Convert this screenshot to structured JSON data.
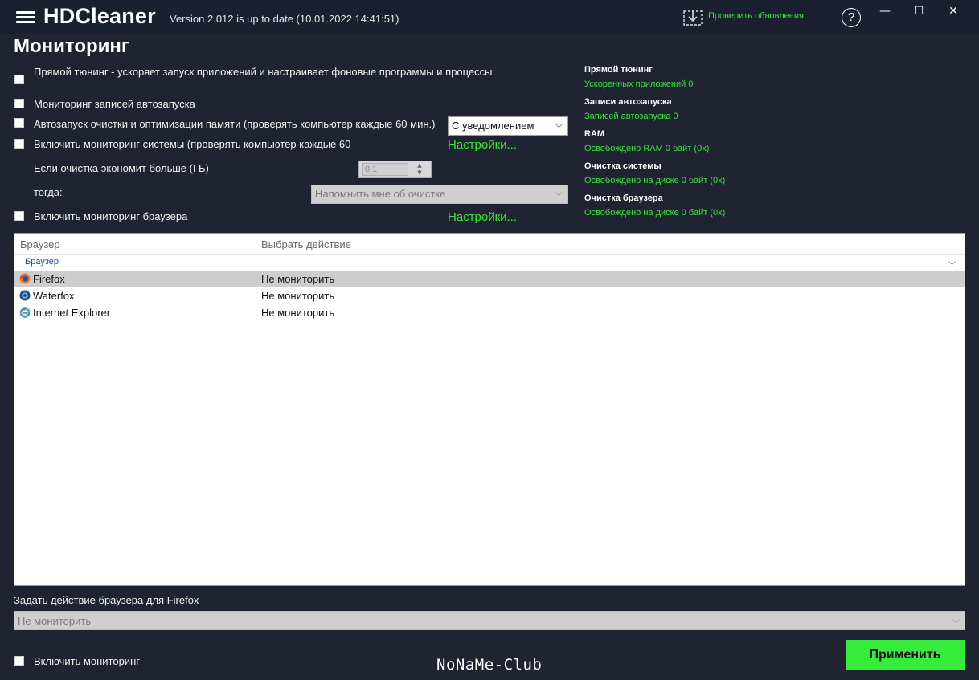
{
  "app": {
    "title": "HDCleaner",
    "version": "Version 2.012 is up to date (10.01.2022 14:41:51)",
    "check_updates": "Проверить обновления",
    "help_glyph": "?",
    "min_glyph": "—",
    "max_glyph": "☐",
    "close_glyph": "✕"
  },
  "page": {
    "title": "Мониторинг"
  },
  "options": {
    "direct_tuning": "Прямой тюнинг - ускоряет запуск приложений и настраивает фоновые программы и процессы",
    "autostart_monitor": "Мониторинг записей автозапуска",
    "auto_clean": "Автозапуск очистки и оптимизации памяти (проверять компьютер каждые 60 мин.)",
    "auto_clean_mode": "С уведомлением",
    "system_monitor": "Включить мониторинг системы (проверять компьютер каждые 60",
    "settings_link_1": "Настройки...",
    "threshold_label": "Если очистка экономит больше (ГБ)",
    "threshold_value": "0.1",
    "then_label": "тогда:",
    "then_value": "Напомнить мне об очистке",
    "browser_monitor": "Включить мониторинг браузера",
    "settings_link_2": "Настройки..."
  },
  "stats": [
    {
      "title": "Прямой тюнинг",
      "value": "Ускоренных приложений 0"
    },
    {
      "title": "Записи автозапуска",
      "value": "Записей автозапуска 0"
    },
    {
      "title": "RAM",
      "value": "Освобождено RAM 0 байт (0x)"
    },
    {
      "title": "Очистка системы",
      "value": "Освобождено на диске 0 байт (0x)"
    },
    {
      "title": "Очистка браузера",
      "value": "Освобождено на диске 0 байт (0x)"
    }
  ],
  "table": {
    "col_browser": "Браузер",
    "col_action": "Выбрать действие",
    "group": "Браузер",
    "rows": [
      {
        "browser": "Firefox",
        "action": "Не мониторить",
        "icon": "firefox-icon"
      },
      {
        "browser": "Waterfox",
        "action": "Не мониторить",
        "icon": "waterfox-icon"
      },
      {
        "browser": "Internet Explorer",
        "action": "Не мониторить",
        "icon": "internet-explorer-icon"
      }
    ]
  },
  "bottom": {
    "action_label": "Задать действие браузера для Firefox",
    "action_value": "Не мониторить",
    "enable_monitoring": "Включить мониторинг",
    "apply": "Применить",
    "watermark": "NoNaMe-Club"
  },
  "colors": {
    "background": "#1f2332",
    "accent_green": "#37e437",
    "apply_button": "#35ec3a"
  }
}
